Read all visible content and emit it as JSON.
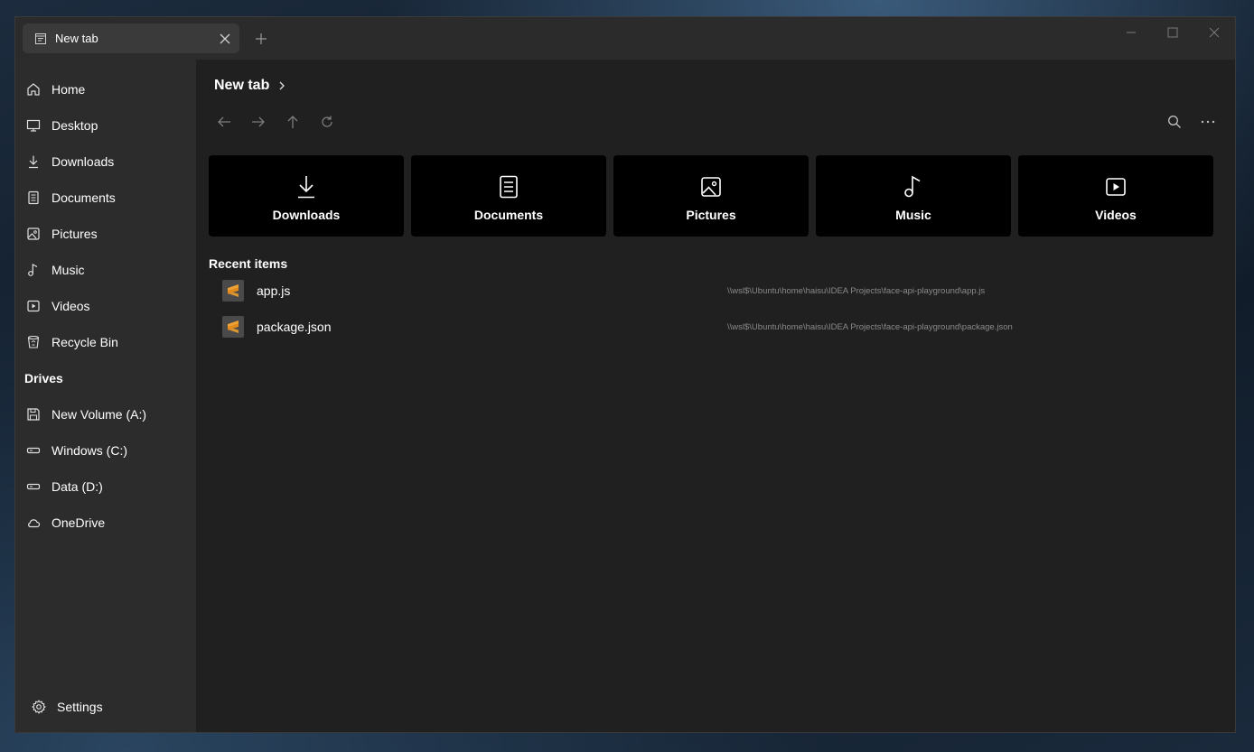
{
  "tab": {
    "title": "New tab"
  },
  "sidebar": {
    "items": [
      {
        "label": "Home",
        "icon": "home-icon"
      },
      {
        "label": "Desktop",
        "icon": "desktop-icon"
      },
      {
        "label": "Downloads",
        "icon": "download-icon"
      },
      {
        "label": "Documents",
        "icon": "document-icon"
      },
      {
        "label": "Pictures",
        "icon": "picture-icon"
      },
      {
        "label": "Music",
        "icon": "music-icon"
      },
      {
        "label": "Videos",
        "icon": "video-icon"
      },
      {
        "label": "Recycle Bin",
        "icon": "recycle-bin-icon"
      }
    ],
    "drives_header": "Drives",
    "drives": [
      {
        "label": "New Volume (A:)",
        "icon": "floppy-drive-icon"
      },
      {
        "label": "Windows (C:)",
        "icon": "hard-drive-icon"
      },
      {
        "label": "Data (D:)",
        "icon": "hard-drive-icon"
      },
      {
        "label": "OneDrive",
        "icon": "cloud-icon"
      }
    ],
    "settings_label": "Settings"
  },
  "main": {
    "breadcrumb": "New tab",
    "quick_access": [
      {
        "label": "Downloads",
        "icon": "download-icon"
      },
      {
        "label": "Documents",
        "icon": "document-icon"
      },
      {
        "label": "Pictures",
        "icon": "picture-icon"
      },
      {
        "label": "Music",
        "icon": "music-icon"
      },
      {
        "label": "Videos",
        "icon": "video-icon"
      }
    ],
    "recent_header": "Recent items",
    "recent_items": [
      {
        "name": "app.js",
        "path": "\\\\wsl$\\Ubuntu\\home\\haisu\\IDEA Projects\\face-api-playground\\app.js"
      },
      {
        "name": "package.json",
        "path": "\\\\wsl$\\Ubuntu\\home\\haisu\\IDEA Projects\\face-api-playground\\package.json"
      }
    ]
  },
  "colors": {
    "window_bg": "#202020",
    "sidebar_bg": "#2c2c2c",
    "card_bg": "#000000",
    "file_icon_accent": "#f0a030"
  }
}
